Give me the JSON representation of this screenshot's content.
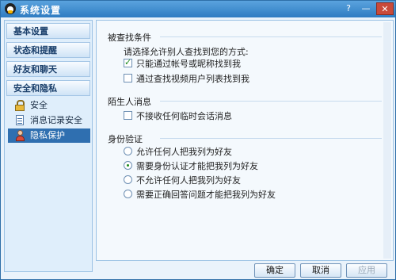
{
  "window": {
    "title": "系统设置"
  },
  "titlebar": {
    "help": "?",
    "minimize": "—",
    "close": "✕"
  },
  "sidebar": {
    "headers": [
      "基本设置",
      "状态和提醒",
      "好友和聊天",
      "安全和隐私"
    ],
    "items": [
      {
        "label": "安全",
        "icon": "lock-icon"
      },
      {
        "label": "消息记录安全",
        "icon": "document-icon"
      },
      {
        "label": "隐私保护",
        "icon": "user-icon",
        "selected": true
      }
    ]
  },
  "sections": {
    "searched": {
      "title": "被查找条件",
      "prompt": "请选择允许别人查找到您的方式:",
      "options": [
        {
          "label": "只能通过帐号或昵称找到我",
          "checked": true
        },
        {
          "label": "通过查找视频用户列表找到我",
          "checked": false
        }
      ]
    },
    "stranger": {
      "title": "陌生人消息",
      "options": [
        {
          "label": "不接收任何临时会话消息",
          "checked": false
        }
      ]
    },
    "verify": {
      "title": "身份验证",
      "options": [
        {
          "label": "允许任何人把我列为好友",
          "selected": false
        },
        {
          "label": "需要身份认证才能把我列为好友",
          "selected": true
        },
        {
          "label": "不允许任何人把我列为好友",
          "selected": false
        },
        {
          "label": "需要正确回答问题才能把我列为好友",
          "selected": false
        }
      ]
    }
  },
  "footer": {
    "ok": "确定",
    "cancel": "取消",
    "apply": "应用",
    "apply_enabled": false
  }
}
